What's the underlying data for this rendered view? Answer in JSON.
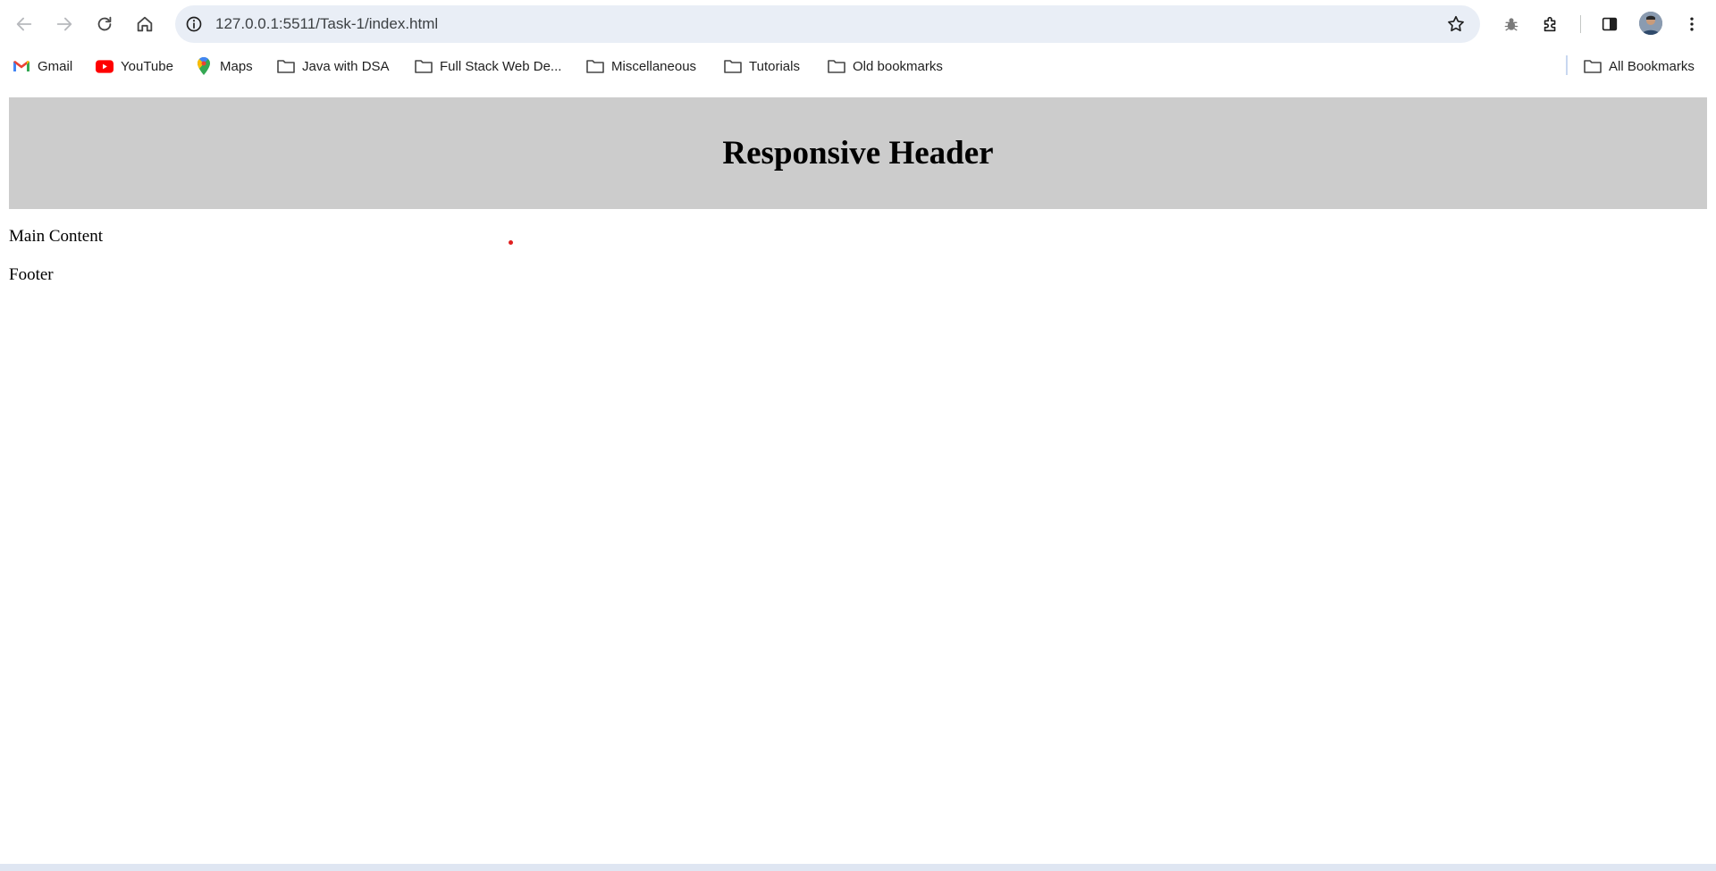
{
  "browser": {
    "url": "127.0.0.1:5511/Task-1/index.html",
    "icons": {
      "back": "arrow-left-icon",
      "forward": "arrow-right-icon",
      "reload": "reload-icon",
      "home": "home-icon",
      "site_info": "info-icon",
      "bookmark": "star-icon",
      "extension_bug": "bug-icon",
      "extensions": "puzzle-icon",
      "side_panel": "side-panel-icon",
      "menu": "kebab-menu-icon"
    }
  },
  "bookmarks": {
    "items": [
      {
        "label": "Gmail",
        "icon": "gmail-icon"
      },
      {
        "label": "YouTube",
        "icon": "youtube-icon"
      },
      {
        "label": "Maps",
        "icon": "maps-pin-icon"
      },
      {
        "label": "Java with DSA",
        "icon": "folder-icon"
      },
      {
        "label": "Full Stack Web De...",
        "icon": "folder-icon"
      },
      {
        "label": "Miscellaneous",
        "icon": "folder-icon"
      },
      {
        "label": "Tutorials",
        "icon": "folder-icon"
      },
      {
        "label": "Old bookmarks",
        "icon": "folder-icon"
      }
    ],
    "all_bookmarks": {
      "label": "All Bookmarks",
      "icon": "folder-icon"
    }
  },
  "page": {
    "header_title": "Responsive Header",
    "main_text": "Main Content",
    "footer_text": "Footer"
  },
  "colors": {
    "header_bg": "#cccccc",
    "omnibox_bg": "#e9eef6",
    "cursor": "#e02020"
  }
}
